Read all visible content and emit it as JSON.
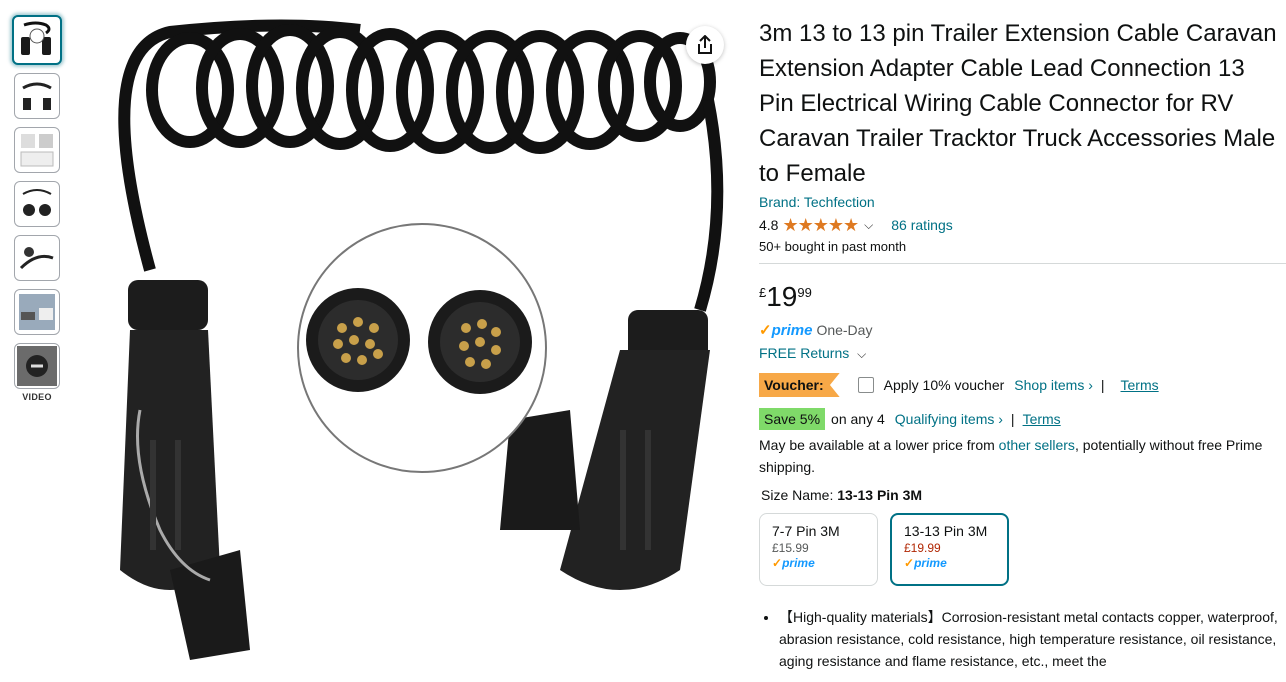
{
  "thumbnails": [
    "thumb-1",
    "thumb-2",
    "thumb-3",
    "thumb-4",
    "thumb-5",
    "thumb-6",
    "thumb-7"
  ],
  "video_label": "VIDEO",
  "title": "3m 13 to 13 pin Trailer Extension Cable Caravan Extension Adapter Cable Lead Connection 13 Pin Electrical Wiring Cable Connector for RV Caravan Trailer Tracktor Truck Accessories Male to Female",
  "brand": "Brand: Techfection",
  "rating": {
    "value": "4.8",
    "stars": "★★★★★",
    "count_text": "86 ratings",
    "bought": "50+ bought in past month"
  },
  "price": {
    "symbol": "£",
    "whole": "19",
    "fraction": "99"
  },
  "prime": {
    "check": "✓",
    "word": "prime",
    "delivery": "One-Day"
  },
  "returns": "FREE Returns",
  "voucher": {
    "badge": "Voucher:",
    "text": "Apply 10% voucher",
    "shop_items": "Shop items ›",
    "separator": "|",
    "terms": "Terms"
  },
  "save": {
    "badge": "Save 5%",
    "text": "on any 4",
    "qualifying": "Qualifying items ›",
    "separator": "|",
    "terms": "Terms"
  },
  "availability": {
    "prefix": "May be available at a lower price from ",
    "link": "other sellers",
    "suffix": ", potentially without free Prime shipping."
  },
  "size": {
    "label": "Size Name: ",
    "selected": "13-13 Pin 3M",
    "options": [
      {
        "name": "7-7 Pin 3M",
        "price": "£15.99",
        "prime": "prime"
      },
      {
        "name": "13-13 Pin 3M",
        "price": "£19.99",
        "prime": "prime"
      }
    ]
  },
  "bullets": [
    "【High-quality materials】Corrosion-resistant metal contacts copper, waterproof, abrasion resistance, cold resistance, high temperature resistance, oil resistance, aging resistance and flame resistance, etc., meet the"
  ],
  "colors": {
    "link": "#007185",
    "star": "#de7921",
    "voucher": "#f7a847",
    "save": "#7fda69",
    "price_red": "#b12704",
    "prime_blue": "#1399ff"
  }
}
